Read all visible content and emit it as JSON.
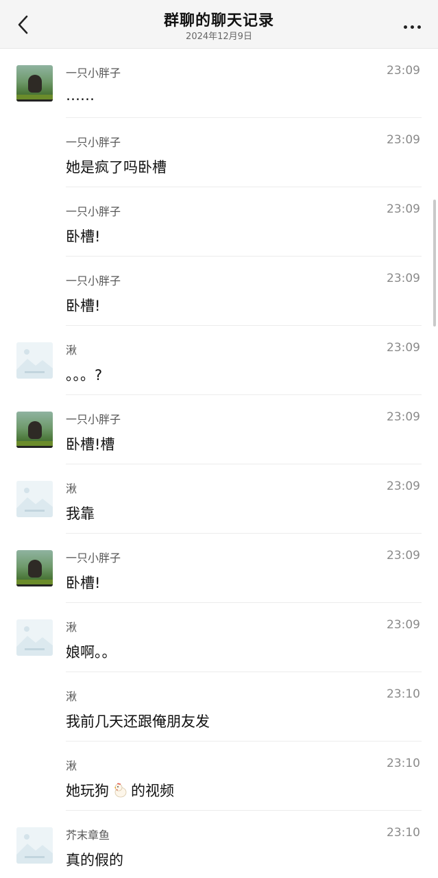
{
  "header": {
    "title": "群聊的聊天记录",
    "date": "2024年12月9日"
  },
  "messages": [
    {
      "sender": "一只小胖子",
      "time": "23:09",
      "text": "……",
      "avatar": "photo"
    },
    {
      "sender": "一只小胖子",
      "time": "23:09",
      "text": "她是疯了吗卧槽",
      "avatar": "none"
    },
    {
      "sender": "一只小胖子",
      "time": "23:09",
      "text": "卧槽!",
      "avatar": "none"
    },
    {
      "sender": "一只小胖子",
      "time": "23:09",
      "text": "卧槽!",
      "avatar": "none"
    },
    {
      "sender": "湫",
      "time": "23:09",
      "text": "。。。?",
      "avatar": "placeholder"
    },
    {
      "sender": "一只小胖子",
      "time": "23:09",
      "text": "卧槽!槽",
      "avatar": "photo"
    },
    {
      "sender": "湫",
      "time": "23:09",
      "text": "我靠",
      "avatar": "placeholder"
    },
    {
      "sender": "一只小胖子",
      "time": "23:09",
      "text": "卧槽!",
      "avatar": "photo"
    },
    {
      "sender": "湫",
      "time": "23:09",
      "text": "娘啊。。",
      "avatar": "placeholder"
    },
    {
      "sender": "湫",
      "time": "23:10",
      "text": "我前几天还跟俺朋友发",
      "avatar": "none"
    },
    {
      "sender": "湫",
      "time": "23:10",
      "text_before": "她玩狗",
      "emoji": "chicken-emoji",
      "text_after": "的视频",
      "avatar": "none"
    },
    {
      "sender": "芥末章鱼",
      "time": "23:10",
      "text": "真的假的",
      "avatar": "placeholder"
    }
  ],
  "icons": {
    "back": "chevron-left-icon",
    "more": "more-dots-icon"
  }
}
